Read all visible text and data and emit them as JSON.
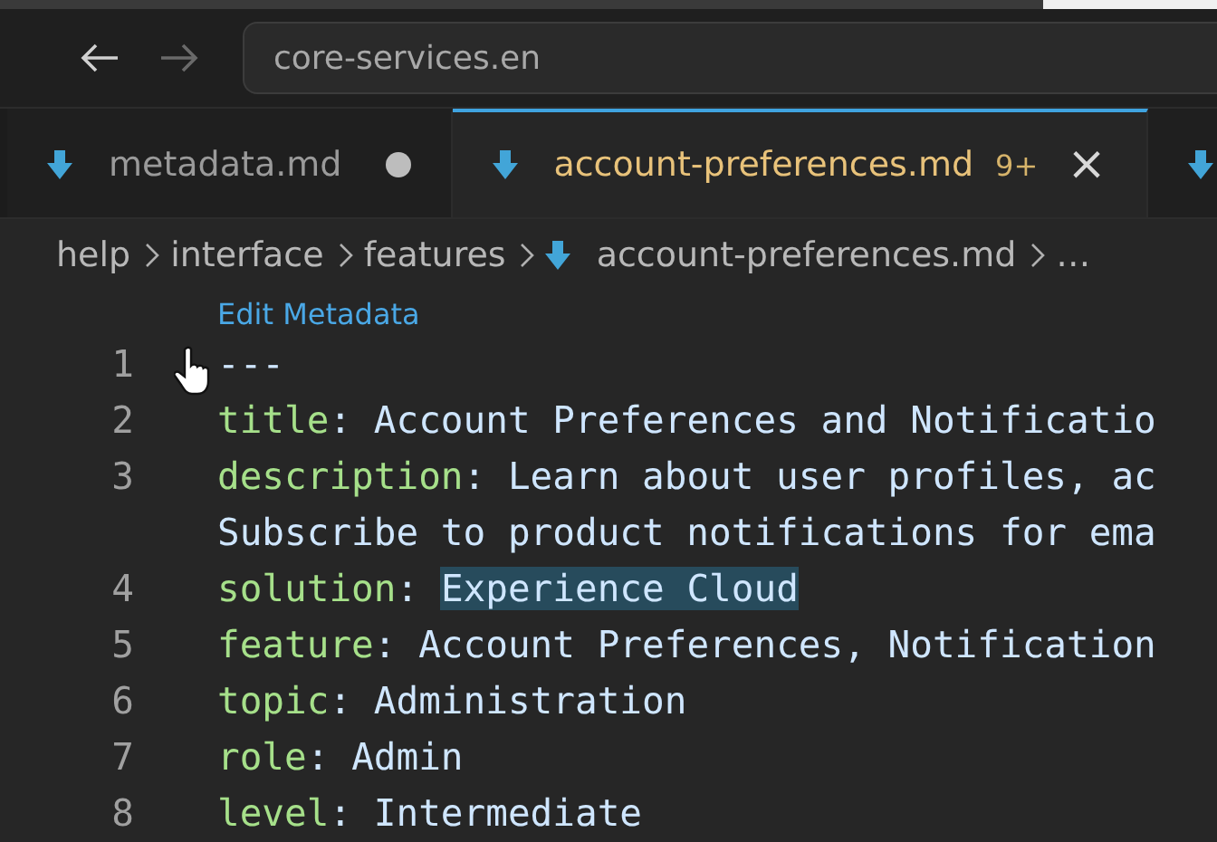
{
  "nav": {
    "back": {
      "disabled": false
    },
    "forward": {
      "disabled": true
    },
    "address": "core-services.en"
  },
  "tabs": [
    {
      "label": "metadata.md",
      "selected": false,
      "modified": true
    },
    {
      "label": "account-preferences.md",
      "selected": true,
      "modified": false,
      "badge": "9+",
      "close": "×"
    },
    {
      "selected": false
    }
  ],
  "breadcrumb": [
    {
      "label": "help"
    },
    {
      "label": "interface"
    },
    {
      "label": "features"
    },
    {
      "label": "account-preferences.md",
      "file": true
    },
    {
      "label": "…"
    }
  ],
  "code_lens": "Edit Metadata",
  "lines": [
    {
      "number": "1",
      "kind": "plain",
      "text": "---"
    },
    {
      "number": "2",
      "kind": "pair",
      "key": "title",
      "separator": ":",
      "value": "Account Preferences and Notificatio",
      "selected": false
    },
    {
      "number": "3",
      "kind": "pair",
      "key": "description",
      "separator": ":",
      "value": "Learn about user profiles, ac",
      "selected": false
    },
    {
      "kind": "plain",
      "text": "Subscribe to product notifications for ema"
    },
    {
      "number": "4",
      "kind": "pair",
      "key": "solution",
      "separator": ":",
      "value": "Experience Cloud",
      "selected": true
    },
    {
      "number": "5",
      "kind": "pair",
      "key": "feature",
      "separator": ":",
      "value": "Account Preferences, Notification",
      "selected": false
    },
    {
      "number": "6",
      "kind": "pair",
      "key": "topic",
      "separator": ":",
      "value": "Administration",
      "selected": false
    },
    {
      "number": "7",
      "kind": "pair",
      "key": "role",
      "separator": ":",
      "value": "Admin",
      "selected": false
    },
    {
      "number": "8",
      "kind": "pair",
      "key": "level",
      "separator": ":",
      "value": "Intermediate",
      "selected": false
    }
  ]
}
